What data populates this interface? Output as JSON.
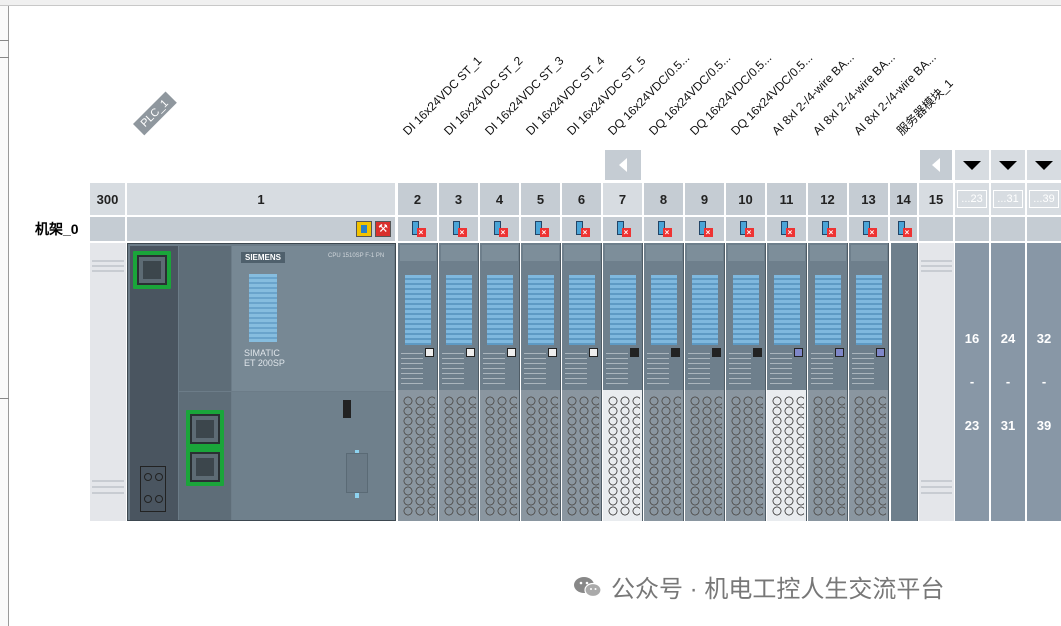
{
  "rack": {
    "label": "机架_0"
  },
  "plc": {
    "tag": "PLC_1",
    "slot_left": "300",
    "slot_cpu": "1",
    "brand": "SIEMENS",
    "model": "SIMATIC ET 200SP",
    "cpu_ref": "CPU 1510SP F-1 PN"
  },
  "modules": [
    {
      "name": "DI 16x24VDC ST_1",
      "slot": "2"
    },
    {
      "name": "DI 16x24VDC ST_2",
      "slot": "3"
    },
    {
      "name": "DI 16x24VDC ST_3",
      "slot": "4"
    },
    {
      "name": "DI 16x24VDC ST_4",
      "slot": "5"
    },
    {
      "name": "DI 16x24VDC ST_5",
      "slot": "6"
    },
    {
      "name": "DQ 16x24VDC/0.5...",
      "slot": "7"
    },
    {
      "name": "DQ 16x24VDC/0.5...",
      "slot": "8"
    },
    {
      "name": "DQ 16x24VDC/0.5...",
      "slot": "9"
    },
    {
      "name": "DQ 16x24VDC/0.5...",
      "slot": "10"
    },
    {
      "name": "AI 8xI 2-/4-wire BA...",
      "slot": "11"
    },
    {
      "name": "AI 8xI 2-/4-wire BA...",
      "slot": "12"
    },
    {
      "name": "AI 8xI 2-/4-wire BA...",
      "slot": "13"
    },
    {
      "name": "服务器模块_1",
      "slot": "14"
    }
  ],
  "extra_slots": {
    "slot15": "15"
  },
  "expand_groups": [
    {
      "header": "...23",
      "from": "16",
      "sep": "-",
      "to": "23"
    },
    {
      "header": "...31",
      "from": "24",
      "sep": "-",
      "to": "31"
    },
    {
      "header": "...39",
      "from": "32",
      "sep": "-",
      "to": "39"
    }
  ],
  "watermark": {
    "text": "公众号 · 机电工控人生交流平台"
  },
  "colors": {
    "slot_header": "#c5ccd3",
    "module_body": "#6e7f8c",
    "port_highlight": "#1aa53a",
    "expand_col": "#8897a6"
  }
}
